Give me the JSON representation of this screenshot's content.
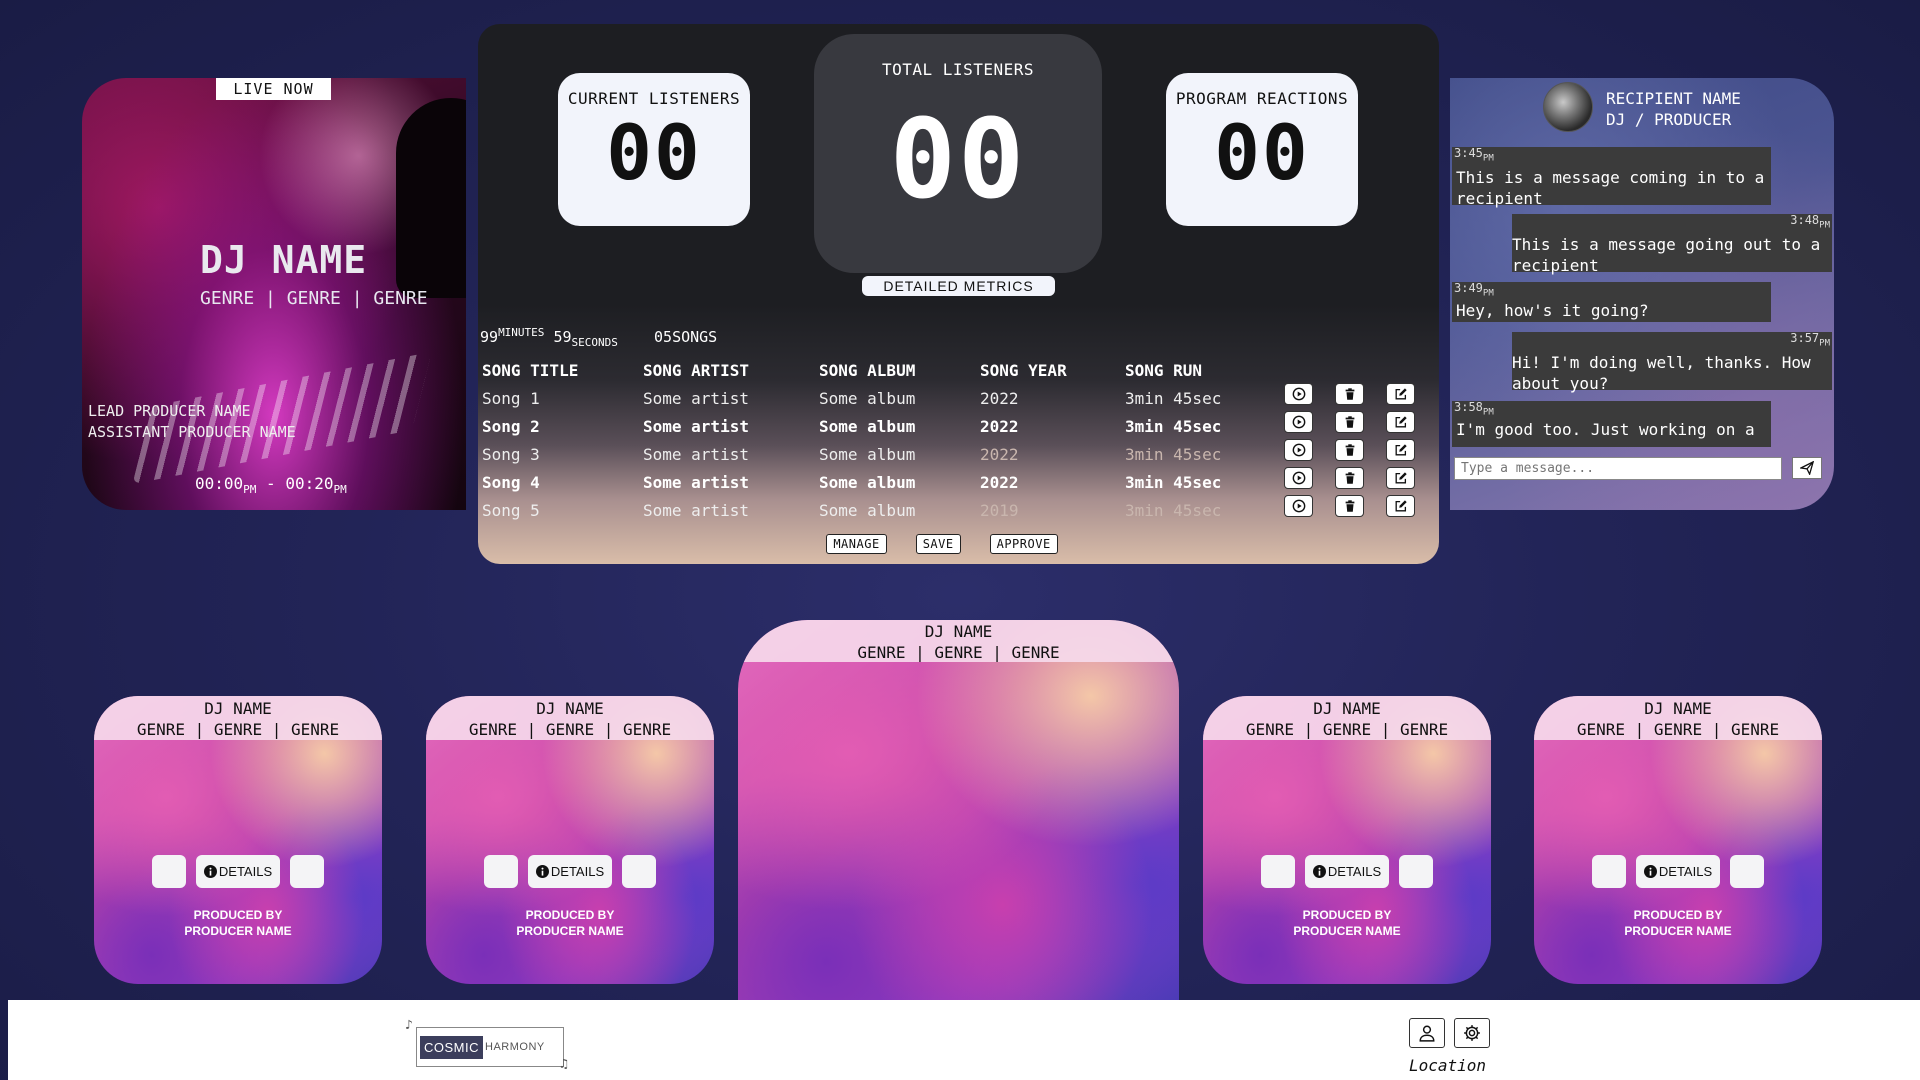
{
  "live": {
    "badge": "LIVE NOW",
    "dj_name": "DJ NAME",
    "genres": "GENRE | GENRE | GENRE",
    "lead_producer": "LEAD PRODUCER NAME",
    "assistant_producer": "ASSISTANT PRODUCER NAME",
    "start_time": "00:00",
    "start_suffix": "PM",
    "separator": " - ",
    "end_time": "00:20",
    "end_suffix": "PM"
  },
  "metrics": {
    "current_listeners_label": "CURRENT LISTENERS",
    "current_listeners": "00",
    "total_listeners_label": "TOTAL LISTENERS",
    "total_listeners": "00",
    "program_reactions_label": "PROGRAM REACTIONS",
    "program_reactions": "00",
    "detailed_button": "DETAILED METRICS",
    "minutes_value": "99",
    "minutes_label": "MINUTES",
    "seconds_value": "59",
    "seconds_label": "SECONDS",
    "songs_value": "05",
    "songs_label": "SONGS"
  },
  "table": {
    "headers": [
      "SONG TITLE",
      "SONG ARTIST",
      "SONG ALBUM",
      "SONG YEAR",
      "SONG RUN"
    ],
    "rows": [
      [
        "Song 1",
        "Some artist",
        "Some album",
        "2022",
        "3min 45sec"
      ],
      [
        "Song 2",
        "Some artist",
        "Some album",
        "2022",
        "3min 45sec"
      ],
      [
        "Song 3",
        "Some artist",
        "Some album",
        "2022",
        "3min 45sec"
      ],
      [
        "Song 4",
        "Some artist",
        "Some album",
        "2022",
        "3min 45sec"
      ],
      [
        "Song 5",
        "Some artist",
        "Some album",
        "2019",
        "3min 45sec"
      ]
    ],
    "manage_button": "MANAGE",
    "save_button": "SAVE",
    "approve_button": "APPROVE"
  },
  "chat": {
    "recipient_name": "RECIPIENT NAME",
    "recipient_role": "DJ / PRODUCER",
    "messages": [
      {
        "time": "3:45",
        "suffix": "PM",
        "text": "This is a message coming in to a recipient"
      },
      {
        "time": "3:48",
        "suffix": "PM",
        "text": "This is a message going out to a recipient"
      },
      {
        "time": "3:49",
        "suffix": "PM",
        "text": "Hey, how's it going?"
      },
      {
        "time": "3:57",
        "suffix": "PM",
        "text": "Hi! I'm doing well, thanks. How about you?"
      },
      {
        "time": "3:58",
        "suffix": "PM",
        "text": "I'm good too. Just working on a"
      }
    ],
    "input_placeholder": "Type a message..."
  },
  "programs": {
    "cards": [
      {
        "dj": "DJ NAME",
        "genres": "GENRE | GENRE | GENRE",
        "details": "DETAILS",
        "produced_by": "PRODUCED BY",
        "producer": "PRODUCER NAME"
      },
      {
        "dj": "DJ NAME",
        "genres": "GENRE | GENRE | GENRE",
        "details": "DETAILS",
        "produced_by": "PRODUCED BY",
        "producer": "PRODUCER NAME"
      },
      {
        "dj": "DJ NAME",
        "genres": "GENRE | GENRE | GENRE"
      },
      {
        "dj": "DJ NAME",
        "genres": "GENRE | GENRE | GENRE",
        "details": "DETAILS",
        "produced_by": "PRODUCED BY",
        "producer": "PRODUCER NAME"
      },
      {
        "dj": "DJ NAME",
        "genres": "GENRE | GENRE | GENRE",
        "details": "DETAILS",
        "produced_by": "PRODUCED BY",
        "producer": "PRODUCER NAME"
      }
    ]
  },
  "footer": {
    "logo_part1": "COSMIC",
    "logo_part2": "HARMONY",
    "location": "Location"
  },
  "icons": {
    "row_actions": [
      "play-icon",
      "trash-icon",
      "edit-icon"
    ],
    "send": "send-icon",
    "profile": "user-icon",
    "settings": "gear-icon",
    "info": "info-icon"
  }
}
